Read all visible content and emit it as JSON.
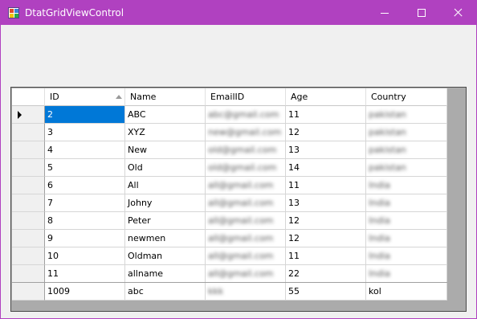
{
  "window": {
    "title": "DtatGridViewControl"
  },
  "grid": {
    "columns": [
      "ID",
      "Name",
      "EmailID",
      "Age",
      "Country"
    ],
    "rows": [
      {
        "id": "2",
        "name": "ABC",
        "email": "abc@gmail.com",
        "age": "11",
        "country": "pakistan"
      },
      {
        "id": "3",
        "name": "XYZ",
        "email": "new@gmail.com",
        "age": "12",
        "country": "pakistan"
      },
      {
        "id": "4",
        "name": "New",
        "email": "old@gmail.com",
        "age": "13",
        "country": "pakistan"
      },
      {
        "id": "5",
        "name": "Old",
        "email": "old@gmail.com",
        "age": "14",
        "country": "pakistan"
      },
      {
        "id": "6",
        "name": "All",
        "email": "all@gmail.com",
        "age": "11",
        "country": "India"
      },
      {
        "id": "7",
        "name": "Johny",
        "email": "all@gmail.com",
        "age": "13",
        "country": "India"
      },
      {
        "id": "8",
        "name": "Peter",
        "email": "all@gmail.com",
        "age": "12",
        "country": "India"
      },
      {
        "id": "9",
        "name": "newmen",
        "email": "all@gmail.com",
        "age": "12",
        "country": "India"
      },
      {
        "id": "10",
        "name": "Oldman",
        "email": "all@gmail.com",
        "age": "11",
        "country": "India"
      },
      {
        "id": "11",
        "name": "allname",
        "email": "all@gmail.com",
        "age": "22",
        "country": "India"
      },
      {
        "id": "1009",
        "name": "abc",
        "email": "kkk",
        "age": "55",
        "country": "kol"
      }
    ]
  },
  "colors": {
    "titlebar": "#b041c0",
    "selection": "#0078d7"
  }
}
